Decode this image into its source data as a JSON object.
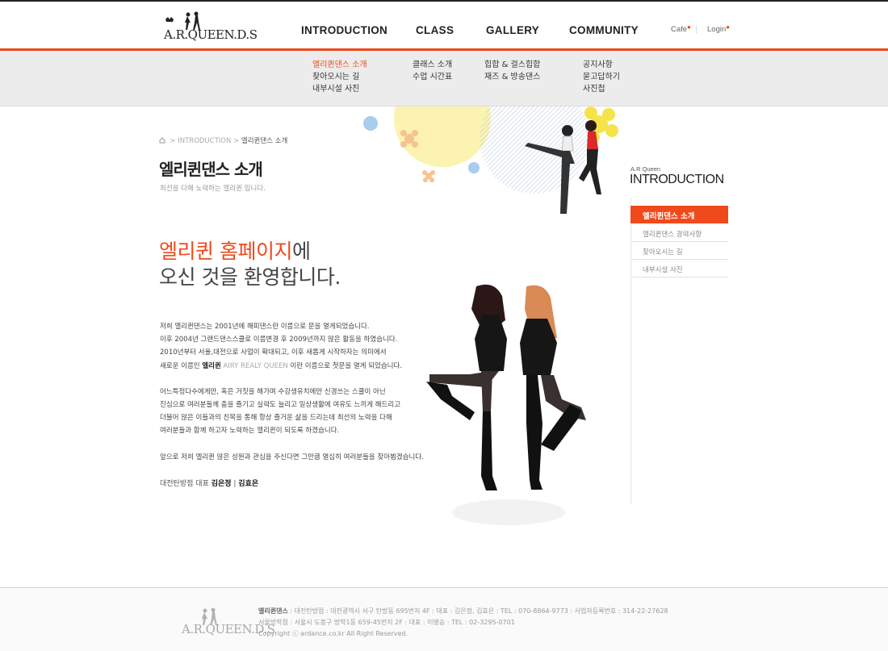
{
  "header": {
    "logo_text": "A.R.QUEEN.D.S",
    "nav": [
      "INTRODUCTION",
      "CLASS",
      "GALLERY",
      "COMMUNITY"
    ],
    "util": {
      "cafe": "Cafe",
      "login": "Login"
    },
    "accent": "#ee4a1c"
  },
  "submenu": {
    "introduction": [
      "엘리퀸댄스 소개",
      "찾아오시는 길",
      "내부시설 사진"
    ],
    "class": [
      "클래스 소개",
      "수업 시간표"
    ],
    "gallery": [
      "힙합 & 걸스힙합",
      "재즈 & 방송댄스"
    ],
    "community": [
      "공지사항",
      "묻고답하기",
      "사진첩"
    ]
  },
  "breadcrumb": {
    "section": "INTRODUCTION",
    "current": "엘리퀸댄스 소개"
  },
  "page": {
    "title": "엘리퀸댄스 소개",
    "subtitle": "최선을 다해 노력하는 엘리퀸 입니다."
  },
  "welcome": {
    "highlight": "엘리퀸 홈페이지",
    "line1_rest": "에",
    "line2": "오신 것을 환영합니다."
  },
  "body": {
    "p1": [
      "저희 엘리퀸댄스는 2001년에 해피댄스란 이름으로 문을 열게되었습니다.",
      "이후 2004년 그랜드댄스스쿨로 이름변경 후 2009년까지 많은 활동을 하였습니다.",
      "2010년부터 서울,대전으로 사업이 확대되고, 이후 새롭게 시작하자는 의미에서"
    ],
    "p1_last_a": "새로운 이름인 ",
    "p1_last_name": "엘리퀸",
    "p1_last_en": " AIRY REALY QUEEN",
    "p1_last_b": " 이란 이름으로 첫문을 열게 되었습니다.",
    "p2": [
      "어느특정다수에게만, 혹은 거짓을 해가며 수강생유치에만 신경쓰는 스쿨이 아닌",
      "진심으로 여러분들께 춤을 즐기고 실력도 늘리고 일상생활에 여유도 느끼게 해드리고",
      "더불어 많은 이들과의 친목을 통해 항상 즐거운 삶을 드리는데  최선의 노력을 다해",
      "여러분들과  함께 하고자 노력하는 엘리퀸이 되도록 하겠습니다."
    ],
    "p3": "앞으로 저희 엘리퀸 많은 성원과 관심을 주신다면 그만큼 열심히 여러분들을 찾아뵙겠습니다.",
    "sign_label": "대전탄방점 대표 ",
    "sign_name1": "김은정",
    "sign_sep": " | ",
    "sign_name2": "김효은"
  },
  "side": {
    "small": "A.R Queen",
    "big": "INTRODUCTION",
    "items": [
      "엘리퀸댄스 소개",
      "엘리퀸댄스 경력사항",
      "찾아오시는 길",
      "내부시설 사진"
    ]
  },
  "footer": {
    "logo_text": "A.R.QUEEN.D.S",
    "name": "엘리퀸댄스",
    "line1": " : 대전탄방점 : 대전광역시 서구 탄방동 695번지 4F  :  대표 : 김은정, 김효은  :  TEL : 070-8864-9773  :  사업자등록번호 : 314-22-27628",
    "line2": "서울방학점 : 서울시 도봉구 방학1동 659-45번지 2F  :  대표 : 이병승  :  TEL : 02-3295-0701",
    "copyright": "Copyright ⓒ ardance.co.kr  All Right Reserved."
  }
}
